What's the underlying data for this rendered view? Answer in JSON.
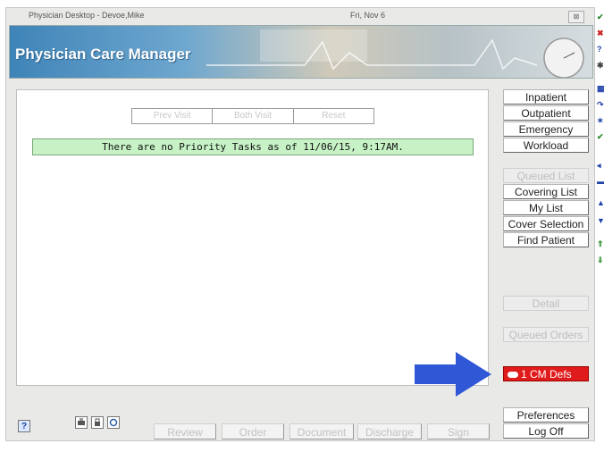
{
  "window": {
    "title": "Physician Desktop - Devoe,Mike",
    "date": "Fri, Nov 6",
    "close_glyph": "⊠"
  },
  "banner": {
    "title": "Physician Care Manager"
  },
  "tabs": [
    "Prev Visit",
    "Both Visit",
    "Reset"
  ],
  "priority_message": "There are no Priority Tasks as of 11/06/15, 9:17AM.",
  "right_panel": {
    "inpatient": "Inpatient",
    "outpatient": "Outpatient",
    "emergency": "Emergency",
    "workload": "Workload",
    "queued_list": "Queued List",
    "covering_list": "Covering List",
    "my_list": "My List",
    "cover_selection": "Cover Selection",
    "find_patient": "Find Patient",
    "detail": "Detail",
    "queued_orders": "Queued Orders",
    "cm_defs": "1 CM Defs",
    "preferences": "Preferences",
    "log_off": "Log Off"
  },
  "bottom_bar": {
    "help": "?",
    "review": "Review",
    "order": "Order",
    "document": "Document",
    "discharge": "Discharge",
    "sign": "Sign"
  },
  "icons": {
    "help_icon": "question-mark-icon",
    "print_icon": "print-icon",
    "lock_icon": "lock-icon",
    "refresh_icon": "refresh-icon",
    "pointer_arrow": "arrow-right-icon",
    "cm_icon": "pill-icon"
  },
  "colors": {
    "priority_bg": "#c6f2c6",
    "cm_defs_bg": "#e01b1b",
    "arrow": "#2f57d6",
    "banner": "#3f84b8"
  }
}
